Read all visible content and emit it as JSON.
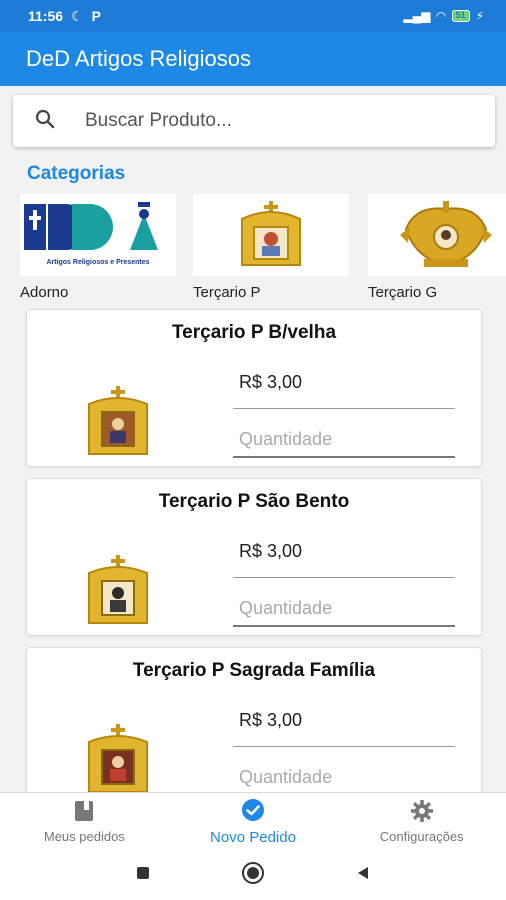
{
  "status_bar": {
    "time": "11:56",
    "battery": "51"
  },
  "app_bar": {
    "title": "DeD Artigos Religiosos"
  },
  "search": {
    "placeholder": "Buscar Produto..."
  },
  "categories": {
    "title": "Categorias",
    "items": [
      {
        "label": "Adorno",
        "logo_text": "Artigos Religiosos e Presentes"
      },
      {
        "label": "Terçario P"
      },
      {
        "label": "Terçario G"
      }
    ]
  },
  "products": [
    {
      "name": "Terçario P B/velha",
      "price": "R$ 3,00",
      "qty_placeholder": "Quantidade"
    },
    {
      "name": "Terçario P São Bento",
      "price": "R$ 3,00",
      "qty_placeholder": "Quantidade"
    },
    {
      "name": "Terçario P Sagrada Família",
      "price": "R$ 3,00",
      "qty_placeholder": "Quantidade"
    }
  ],
  "bottom_nav": {
    "items": [
      {
        "label": "Meus pedidos",
        "icon": "book-icon"
      },
      {
        "label": "Novo Pedido",
        "icon": "check-circle-icon",
        "active": true
      },
      {
        "label": "Configurações",
        "icon": "gear-icon"
      }
    ]
  },
  "colors": {
    "primary": "#1e88e5",
    "status_bar": "#1e7bd6",
    "gold": "#d4a017"
  }
}
